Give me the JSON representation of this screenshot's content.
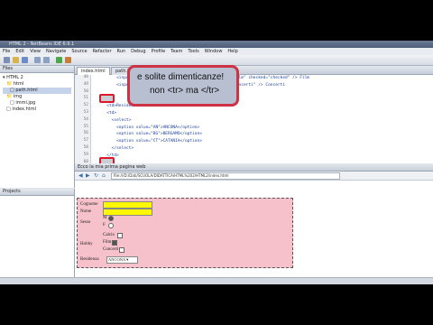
{
  "window": {
    "title": "HTML 2 - NetBeans IDE 6.9.1"
  },
  "menu": [
    "File",
    "Edit",
    "View",
    "Navigate",
    "Source",
    "Refactor",
    "Run",
    "Debug",
    "Profile",
    "Team",
    "Tools",
    "Window",
    "Help"
  ],
  "projects_panel": {
    "title": "Projects"
  },
  "files_panel": {
    "title": "Files",
    "tree": [
      "HTML 2",
      "html",
      "path.html",
      "img",
      "immi.jpg",
      "index.html"
    ]
  },
  "editor": {
    "tabs": [
      "index.html",
      "path.html"
    ],
    "line_numbers": [
      "48",
      "49",
      "50",
      "51",
      "52",
      "53",
      "54",
      "55",
      "56",
      "57",
      "58",
      "59",
      "60",
      "61",
      "62",
      "63"
    ],
    "code": [
      "          <input type=\"checkbox\" name=\"hobbyCheck\" value=\"Film\" checked=\"checked\" /> Film",
      "          <input type=\"checkbox\" name=\"hobbyCheck\" value=\"Concerti\" /> Concerti",
      "",
      "    <tr>",
      "      <td>Residenza</td>",
      "      <td>",
      "        <select>",
      "          <option value=\"AN\">ANCONA</option>",
      "          <option value=\"BG\">BERGAMO</option>",
      "          <option value=\"CT\">CATANIA</option>",
      "        </select>",
      "      </td>",
      "",
      "    </tr>",
      "",
      ""
    ]
  },
  "callout": {
    "line1": "e solite dimenticanze!",
    "line2": "non <tr> ma </tr>"
  },
  "browser": {
    "title": "Ecco la mia prima pagina web",
    "url": "file:///D:/Dati/SCUOLA/DIDATTICA/HTML%202/HTML2/index.html"
  },
  "form": {
    "labels": {
      "cognome": "Cognome",
      "nome": "Nome",
      "sesso": "Sesso",
      "hobby": "Hobby",
      "residenza": "Residenza"
    },
    "sex_options": [
      "M",
      "F"
    ],
    "hobbies": [
      "Calcio",
      "Film",
      "Concerti"
    ],
    "residenza_selected": "ANCONA"
  },
  "colors": {
    "highlight": "#e0162b",
    "form_bg": "#f7c1cb",
    "input_bg": "#fff700"
  }
}
